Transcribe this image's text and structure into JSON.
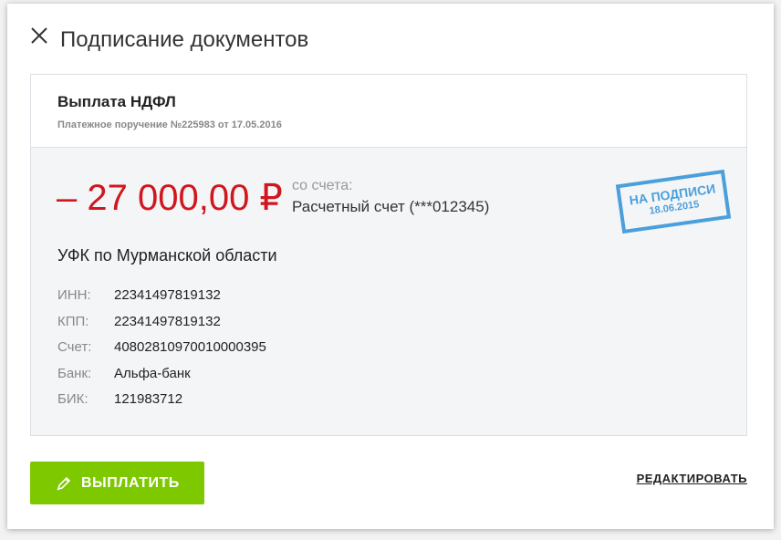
{
  "dialog": {
    "title": "Подписание документов"
  },
  "document": {
    "title": "Выплата НДФЛ",
    "subtitle": "Платежное поручение №225983 от 17.05.2016",
    "amount": "– 27 000,00 ₽",
    "from_label": "со счета:",
    "from_value": "Расчетный счет (***012345)",
    "stamp": {
      "status": "НА ПОДПИСИ",
      "date": "18.06.2015",
      "color": "#4a9fdc"
    },
    "recipient": "УФК по Мурманской области",
    "details": [
      {
        "label": "ИНН:",
        "value": "22341497819132"
      },
      {
        "label": "КПП:",
        "value": "22341497819132"
      },
      {
        "label": "Счет:",
        "value": "40802810970010000395"
      },
      {
        "label": "Банк:",
        "value": "Альфа-банк"
      },
      {
        "label": "БИК:",
        "value": "121983712"
      }
    ]
  },
  "actions": {
    "pay_label": "ВЫПЛАТИТЬ",
    "edit_label": "РЕДАКТИРОВАТЬ"
  },
  "colors": {
    "amount": "#d0161e",
    "pay_button": "#7ec800"
  }
}
